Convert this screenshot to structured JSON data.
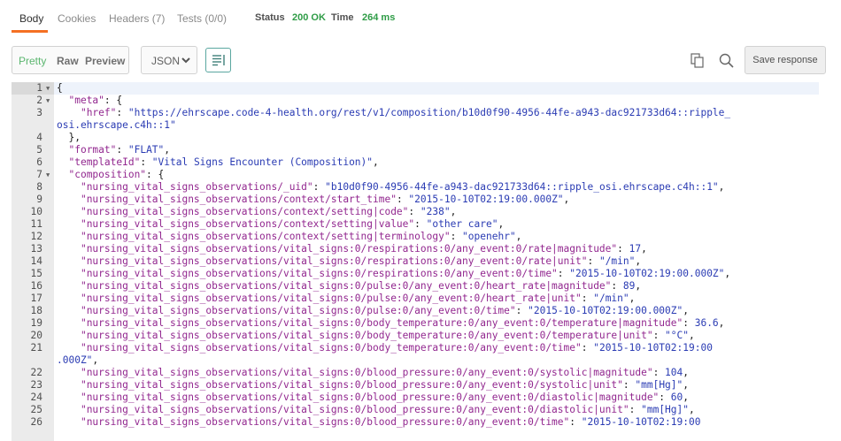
{
  "tabs": [
    {
      "label": "Body"
    },
    {
      "label": "Cookies"
    },
    {
      "label": "Headers (7)"
    },
    {
      "label": "Tests (0/0)"
    }
  ],
  "status": {
    "label": "Status",
    "value": "200 OK"
  },
  "time": {
    "label": "Time",
    "value": "264 ms"
  },
  "colors": {
    "accent": "#f47023",
    "ok": "#2e9c46",
    "key": "#92278f",
    "string": "#2a3bb3"
  },
  "toolbar": {
    "view_modes": [
      "Pretty",
      "Raw",
      "Preview"
    ],
    "active_view": "Pretty",
    "format": "JSON",
    "save_label": "Save response",
    "icons": [
      "chevron-down-icon",
      "wrap-lines-icon",
      "copy-icon",
      "search-icon"
    ]
  },
  "editor": {
    "lines": [
      {
        "num": "1",
        "fold": true,
        "segs": [
          [
            "p",
            "{"
          ]
        ]
      },
      {
        "num": "2",
        "fold": true,
        "segs": [
          [
            "p",
            "  "
          ],
          [
            "k",
            "\"meta\""
          ],
          [
            "p",
            ": {"
          ]
        ]
      },
      {
        "num": "3",
        "segs": [
          [
            "p",
            "    "
          ],
          [
            "k",
            "\"href\""
          ],
          [
            "p",
            ": "
          ],
          [
            "s",
            "\"https://ehrscape.code-4-health.org/rest/v1/composition/b10d0f90-4956-44fe-a943-dac921733d64::ripple_"
          ]
        ]
      },
      {
        "num": "",
        "segs": [
          [
            "s",
            "osi.ehrscape.c4h::1\""
          ]
        ]
      },
      {
        "num": "4",
        "segs": [
          [
            "p",
            "  },"
          ]
        ]
      },
      {
        "num": "5",
        "segs": [
          [
            "p",
            "  "
          ],
          [
            "k",
            "\"format\""
          ],
          [
            "p",
            ": "
          ],
          [
            "s",
            "\"FLAT\""
          ],
          [
            "p",
            ","
          ]
        ]
      },
      {
        "num": "6",
        "segs": [
          [
            "p",
            "  "
          ],
          [
            "k",
            "\"templateId\""
          ],
          [
            "p",
            ": "
          ],
          [
            "s",
            "\"Vital Signs Encounter (Composition)\""
          ],
          [
            "p",
            ","
          ]
        ]
      },
      {
        "num": "7",
        "fold": true,
        "segs": [
          [
            "p",
            "  "
          ],
          [
            "k",
            "\"composition\""
          ],
          [
            "p",
            ": {"
          ]
        ]
      },
      {
        "num": "8",
        "segs": [
          [
            "p",
            "    "
          ],
          [
            "k",
            "\"nursing_vital_signs_observations/_uid\""
          ],
          [
            "p",
            ": "
          ],
          [
            "s",
            "\"b10d0f90-4956-44fe-a943-dac921733d64::ripple_osi.ehrscape.c4h::1\""
          ],
          [
            "p",
            ","
          ]
        ]
      },
      {
        "num": "9",
        "segs": [
          [
            "p",
            "    "
          ],
          [
            "k",
            "\"nursing_vital_signs_observations/context/start_time\""
          ],
          [
            "p",
            ": "
          ],
          [
            "s",
            "\"2015-10-10T02:19:00.000Z\""
          ],
          [
            "p",
            ","
          ]
        ]
      },
      {
        "num": "10",
        "segs": [
          [
            "p",
            "    "
          ],
          [
            "k",
            "\"nursing_vital_signs_observations/context/setting|code\""
          ],
          [
            "p",
            ": "
          ],
          [
            "s",
            "\"238\""
          ],
          [
            "p",
            ","
          ]
        ]
      },
      {
        "num": "11",
        "segs": [
          [
            "p",
            "    "
          ],
          [
            "k",
            "\"nursing_vital_signs_observations/context/setting|value\""
          ],
          [
            "p",
            ": "
          ],
          [
            "s",
            "\"other care\""
          ],
          [
            "p",
            ","
          ]
        ]
      },
      {
        "num": "12",
        "segs": [
          [
            "p",
            "    "
          ],
          [
            "k",
            "\"nursing_vital_signs_observations/context/setting|terminology\""
          ],
          [
            "p",
            ": "
          ],
          [
            "s",
            "\"openehr\""
          ],
          [
            "p",
            ","
          ]
        ]
      },
      {
        "num": "13",
        "segs": [
          [
            "p",
            "    "
          ],
          [
            "k",
            "\"nursing_vital_signs_observations/vital_signs:0/respirations:0/any_event:0/rate|magnitude\""
          ],
          [
            "p",
            ": "
          ],
          [
            "n",
            "17"
          ],
          [
            "p",
            ","
          ]
        ]
      },
      {
        "num": "14",
        "segs": [
          [
            "p",
            "    "
          ],
          [
            "k",
            "\"nursing_vital_signs_observations/vital_signs:0/respirations:0/any_event:0/rate|unit\""
          ],
          [
            "p",
            ": "
          ],
          [
            "s",
            "\"/min\""
          ],
          [
            "p",
            ","
          ]
        ]
      },
      {
        "num": "15",
        "segs": [
          [
            "p",
            "    "
          ],
          [
            "k",
            "\"nursing_vital_signs_observations/vital_signs:0/respirations:0/any_event:0/time\""
          ],
          [
            "p",
            ": "
          ],
          [
            "s",
            "\"2015-10-10T02:19:00.000Z\""
          ],
          [
            "p",
            ","
          ]
        ]
      },
      {
        "num": "16",
        "segs": [
          [
            "p",
            "    "
          ],
          [
            "k",
            "\"nursing_vital_signs_observations/vital_signs:0/pulse:0/any_event:0/heart_rate|magnitude\""
          ],
          [
            "p",
            ": "
          ],
          [
            "n",
            "89"
          ],
          [
            "p",
            ","
          ]
        ]
      },
      {
        "num": "17",
        "segs": [
          [
            "p",
            "    "
          ],
          [
            "k",
            "\"nursing_vital_signs_observations/vital_signs:0/pulse:0/any_event:0/heart_rate|unit\""
          ],
          [
            "p",
            ": "
          ],
          [
            "s",
            "\"/min\""
          ],
          [
            "p",
            ","
          ]
        ]
      },
      {
        "num": "18",
        "segs": [
          [
            "p",
            "    "
          ],
          [
            "k",
            "\"nursing_vital_signs_observations/vital_signs:0/pulse:0/any_event:0/time\""
          ],
          [
            "p",
            ": "
          ],
          [
            "s",
            "\"2015-10-10T02:19:00.000Z\""
          ],
          [
            "p",
            ","
          ]
        ]
      },
      {
        "num": "19",
        "segs": [
          [
            "p",
            "    "
          ],
          [
            "k",
            "\"nursing_vital_signs_observations/vital_signs:0/body_temperature:0/any_event:0/temperature|magnitude\""
          ],
          [
            "p",
            ": "
          ],
          [
            "n",
            "36.6"
          ],
          [
            "p",
            ","
          ]
        ]
      },
      {
        "num": "20",
        "segs": [
          [
            "p",
            "    "
          ],
          [
            "k",
            "\"nursing_vital_signs_observations/vital_signs:0/body_temperature:0/any_event:0/temperature|unit\""
          ],
          [
            "p",
            ": "
          ],
          [
            "s",
            "\"°C\""
          ],
          [
            "p",
            ","
          ]
        ]
      },
      {
        "num": "21",
        "segs": [
          [
            "p",
            "    "
          ],
          [
            "k",
            "\"nursing_vital_signs_observations/vital_signs:0/body_temperature:0/any_event:0/time\""
          ],
          [
            "p",
            ": "
          ],
          [
            "s",
            "\"2015-10-10T02:19:00"
          ]
        ]
      },
      {
        "num": "",
        "segs": [
          [
            "s",
            ".000Z\""
          ],
          [
            "p",
            ","
          ]
        ]
      },
      {
        "num": "22",
        "segs": [
          [
            "p",
            "    "
          ],
          [
            "k",
            "\"nursing_vital_signs_observations/vital_signs:0/blood_pressure:0/any_event:0/systolic|magnitude\""
          ],
          [
            "p",
            ": "
          ],
          [
            "n",
            "104"
          ],
          [
            "p",
            ","
          ]
        ]
      },
      {
        "num": "23",
        "segs": [
          [
            "p",
            "    "
          ],
          [
            "k",
            "\"nursing_vital_signs_observations/vital_signs:0/blood_pressure:0/any_event:0/systolic|unit\""
          ],
          [
            "p",
            ": "
          ],
          [
            "s",
            "\"mm[Hg]\""
          ],
          [
            "p",
            ","
          ]
        ]
      },
      {
        "num": "24",
        "segs": [
          [
            "p",
            "    "
          ],
          [
            "k",
            "\"nursing_vital_signs_observations/vital_signs:0/blood_pressure:0/any_event:0/diastolic|magnitude\""
          ],
          [
            "p",
            ": "
          ],
          [
            "n",
            "60"
          ],
          [
            "p",
            ","
          ]
        ]
      },
      {
        "num": "25",
        "segs": [
          [
            "p",
            "    "
          ],
          [
            "k",
            "\"nursing_vital_signs_observations/vital_signs:0/blood_pressure:0/any_event:0/diastolic|unit\""
          ],
          [
            "p",
            ": "
          ],
          [
            "s",
            "\"mm[Hg]\""
          ],
          [
            "p",
            ","
          ]
        ]
      },
      {
        "num": "26",
        "segs": [
          [
            "p",
            "    "
          ],
          [
            "k",
            "\"nursing_vital_signs_observations/vital_signs:0/blood_pressure:0/any_event:0/time\""
          ],
          [
            "p",
            ": "
          ],
          [
            "s",
            "\"2015-10-10T02:19:00"
          ]
        ]
      }
    ]
  }
}
